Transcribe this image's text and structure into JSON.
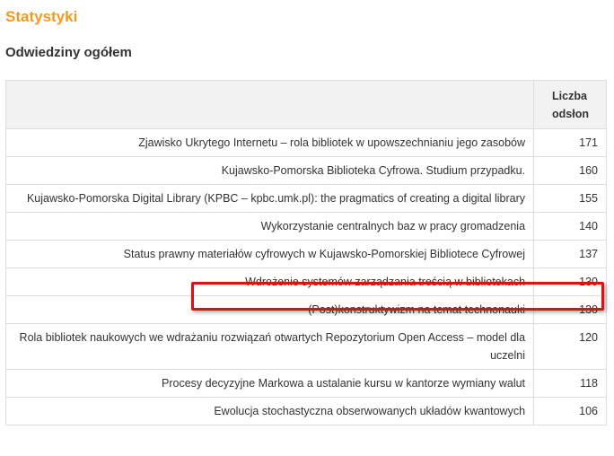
{
  "page": {
    "title": "Statystyki",
    "section_title": "Odwiedziny ogółem"
  },
  "table": {
    "headers": {
      "title": "",
      "count": "Liczba odsłon"
    },
    "rows": [
      {
        "title": "Zjawisko Ukrytego Internetu – rola bibliotek w upowszechnianiu jego zasobów",
        "count": "171"
      },
      {
        "title": "Kujawsko-Pomorska Biblioteka Cyfrowa. Studium przypadku.",
        "count": "160"
      },
      {
        "title": "Kujawsko-Pomorska Digital Library (KPBC – kpbc.umk.pl): the pragmatics of creating a digital library",
        "count": "155"
      },
      {
        "title": "Wykorzystanie centralnych baz w pracy gromadzenia",
        "count": "140"
      },
      {
        "title": "Status prawny materiałów cyfrowych w Kujawsko-Pomorskiej Bibliotece Cyfrowej",
        "count": "137"
      },
      {
        "title": "Wdrożenie systemów zarządzania treścią w bibliotekach",
        "count": "130"
      },
      {
        "title": "(Post)konstruktywizm na temat technonauki",
        "count": "130"
      },
      {
        "title": "Rola bibliotek naukowych we wdrażaniu rozwiązań otwartych Repozytorium Open Access – model dla uczelni",
        "count": "120"
      },
      {
        "title": "Procesy decyzyjne Markowa a ustalanie kursu w kantorze wymiany walut",
        "count": "118"
      },
      {
        "title": "Ewolucja stochastyczna obserwowanych układów kwantowych",
        "count": "106"
      }
    ]
  },
  "colors": {
    "heading": "#f39a1e",
    "highlight": "#dd1111",
    "header_bg": "#f2f2f2",
    "border": "#dddddd"
  }
}
